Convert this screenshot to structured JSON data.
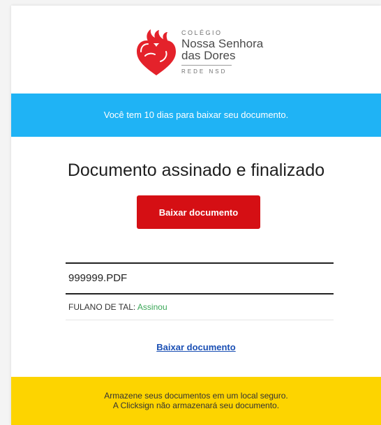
{
  "header": {
    "logo_icon": "flaming-heart-icon",
    "brand_color": "#e4222b",
    "colegio": "COLÉGIO",
    "name_line1": "Nossa Senhora",
    "name_line2": "das Dores",
    "rede": "REDE NSD"
  },
  "notice": {
    "text": "Você tem 10 dias para baixar seu documento.",
    "color": "#1fb3f5"
  },
  "main": {
    "title": "Documento assinado e finalizado",
    "download_button": "Baixar documento",
    "button_color": "#d50f14"
  },
  "document": {
    "filename": "999999.PDF",
    "signer_name": "FULANO DE TAL:",
    "signer_status": "Assinou",
    "status_color": "#3aa757"
  },
  "download_link": "Baixar documento",
  "footer": {
    "line1": "Armazene seus documentos em um local seguro.",
    "line2": "A Clicksign não armazenará seu documento.",
    "color": "#fdd400"
  }
}
